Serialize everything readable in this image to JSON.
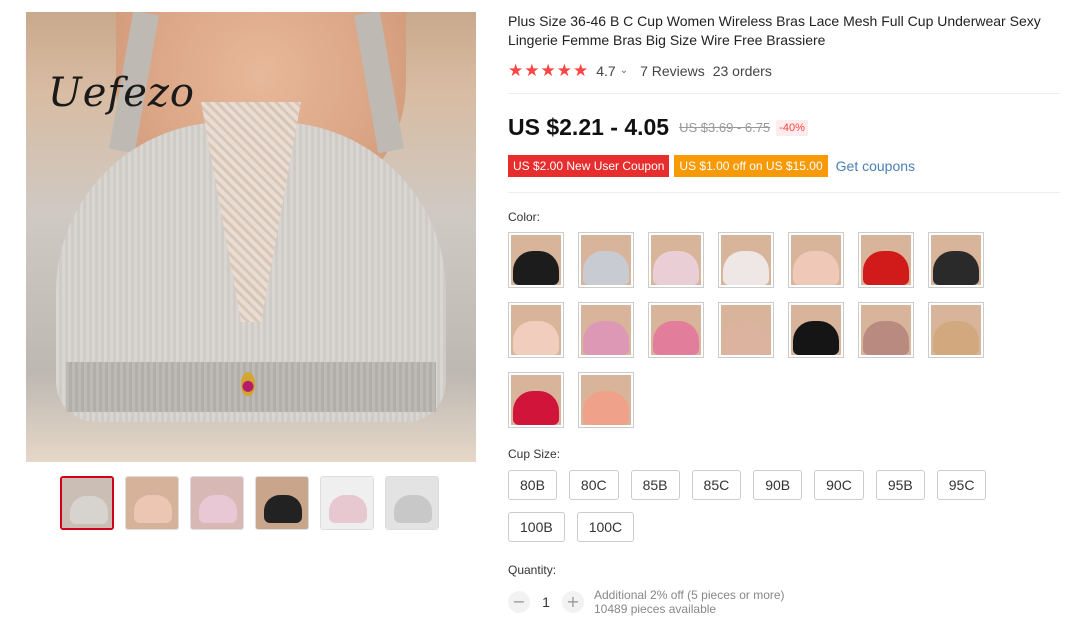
{
  "gallery": {
    "brand_logo": "Uefezo",
    "thumbnails": [
      {
        "label": "light-grey",
        "bg": "#cbbfb5",
        "cup": "#d7d4d0"
      },
      {
        "label": "nude",
        "bg": "#d7b29a",
        "cup": "#edc6b3"
      },
      {
        "label": "pink",
        "bg": "#d8b8b4",
        "cup": "#e7c8d4"
      },
      {
        "label": "black",
        "bg": "#c9a58c",
        "cup": "#222222"
      },
      {
        "label": "set",
        "bg": "#efefef",
        "cup": "#e7c7d0"
      },
      {
        "label": "detail",
        "bg": "#e3e3e3",
        "cup": "#c8c8c8"
      }
    ]
  },
  "product": {
    "title": "Plus Size 36-46 B C Cup Women Wireless Bras Lace Mesh Full Cup Underwear Sexy Lingerie Femme Bras Big Size Wire Free Brassiere",
    "rating": "4.7",
    "reviews": "7 Reviews",
    "orders": "23 orders",
    "price": "US $2.21 - 4.05",
    "old_price": "US $3.69 - 6.75",
    "discount": "-40%",
    "coupons": {
      "new_user": "US $2.00 New User Coupon",
      "off": "US $1.00 off on US $15.00",
      "get": "Get coupons"
    }
  },
  "color": {
    "label": "Color:",
    "swatches": [
      {
        "name": "black",
        "bra": "#1c1c1c"
      },
      {
        "name": "grey",
        "bra": "#c9cbd3"
      },
      {
        "name": "light-pink",
        "bra": "#e9cfd5"
      },
      {
        "name": "white",
        "bra": "#eee7e6"
      },
      {
        "name": "nude",
        "bra": "#f0c8b8"
      },
      {
        "name": "red",
        "bra": "#d11a1a"
      },
      {
        "name": "black-lace",
        "bra": "#2a2a2a"
      },
      {
        "name": "skin",
        "bra": "#f0cdbd"
      },
      {
        "name": "pink-lace",
        "bra": "#dc98b4"
      },
      {
        "name": "rose",
        "bra": "#e27d9c"
      },
      {
        "name": "beige-lace",
        "bra": "#dcb39e"
      },
      {
        "name": "black-smooth",
        "bra": "#151515"
      },
      {
        "name": "mauve",
        "bra": "#b88a80"
      },
      {
        "name": "tan",
        "bra": "#d2a87e"
      },
      {
        "name": "red-smooth",
        "bra": "#d0143a"
      },
      {
        "name": "peach",
        "bra": "#f0a18a"
      }
    ]
  },
  "cup_size": {
    "label": "Cup Size:",
    "options": [
      "80B",
      "80C",
      "85B",
      "85C",
      "90B",
      "90C",
      "95B",
      "95C",
      "100B",
      "100C"
    ]
  },
  "quantity": {
    "label": "Quantity:",
    "value": "1",
    "minus": "−",
    "plus": "+",
    "note_line1": "Additional 2% off (5 pieces or more)",
    "note_line2": "10489 pieces available"
  }
}
